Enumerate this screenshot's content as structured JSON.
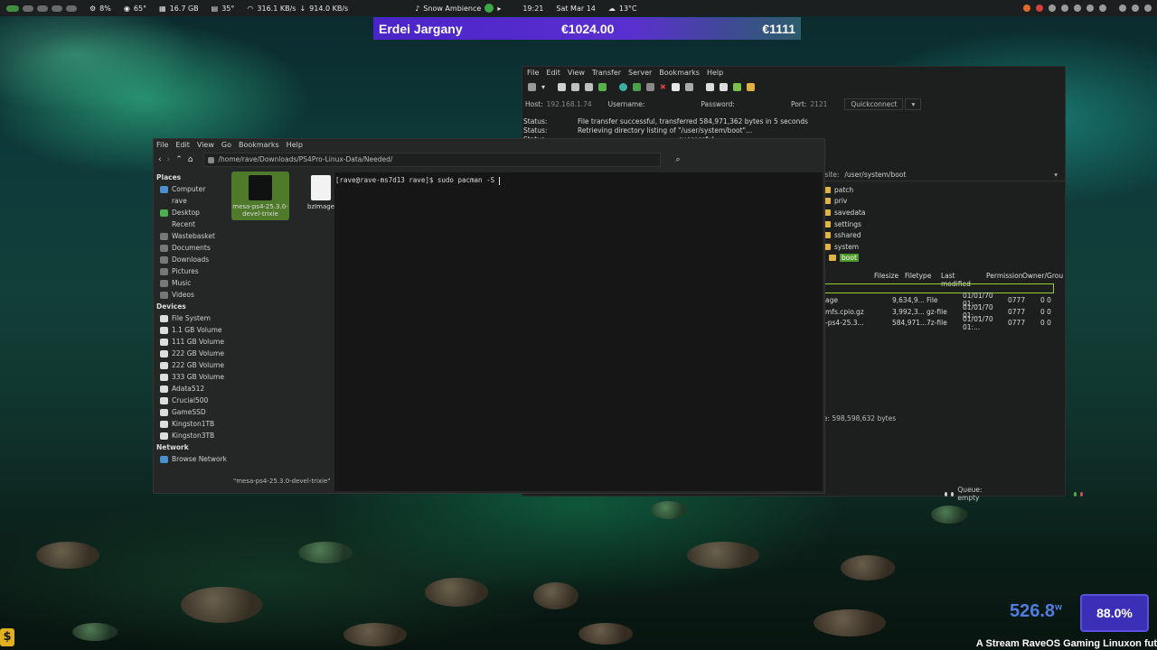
{
  "topbar": {
    "cpu": "8%",
    "temp": "65°",
    "ram": "16.7 GB",
    "temp2": "35°",
    "net_down": "316.1 KB/s",
    "net_up": "914.0 KB/s",
    "music": "Snow Ambience",
    "time": "19:21",
    "date": "Sat Mar 14",
    "weather": "13°C"
  },
  "banner": {
    "name": "Erdei Jargany",
    "amount": "€1024.00",
    "goal": "€1111"
  },
  "filezilla": {
    "menu": [
      "File",
      "Edit",
      "View",
      "Transfer",
      "Server",
      "Bookmarks",
      "Help"
    ],
    "host_label": "Host:",
    "host": "192.168.1.74",
    "user_label": "Username:",
    "pass_label": "Password:",
    "port_label": "Port:",
    "port": "2121",
    "quickconnect": "Quickconnect",
    "log": [
      {
        "k": "Status:",
        "v": "File transfer successful, transferred 584,971,362 bytes in 5 seconds"
      },
      {
        "k": "Status:",
        "v": "Retrieving directory listing of \"/user/system/boot\"..."
      },
      {
        "k": "Status:",
        "v": "successful"
      }
    ],
    "remote_label": "Remote site:",
    "remote_path": "/user/system/boot",
    "tree": [
      "patch",
      "priv",
      "savedata",
      "settings",
      "sshared",
      "system",
      "boot"
    ],
    "columns": [
      "Filesize",
      "Filetype",
      "Last modified",
      "Permission",
      "Owner/Group"
    ],
    "files": [
      {
        "name": "age",
        "size": "9,634,9...",
        "type": "File",
        "mod": "01/01/70 01:...",
        "perm": "0777",
        "own": "0 0"
      },
      {
        "name": "mfs.cpio.gz",
        "size": "3,992,3...",
        "type": "gz-file",
        "mod": "01/01/70 01:...",
        "perm": "0777",
        "own": "0 0"
      },
      {
        "name": "-ps4-25.3...",
        "size": "584,971...",
        "type": "7z-file",
        "mod": "01/01/70 01:...",
        "perm": "0777",
        "own": "0 0"
      }
    ],
    "total": "Total size: 598,598,632 bytes",
    "queue": "Queue: empty"
  },
  "filemanager": {
    "menu": [
      "File",
      "Edit",
      "View",
      "Go",
      "Bookmarks",
      "Help"
    ],
    "path": "/home/rave/Downloads/PS4Pro-Linux-Data/Needed/",
    "places_header": "Places",
    "places": [
      "Computer",
      "rave",
      "Desktop",
      "Recent",
      "Wastebasket",
      "Documents",
      "Downloads",
      "Pictures",
      "Music",
      "Videos"
    ],
    "devices_header": "Devices",
    "devices": [
      "File System",
      "1.1 GB Volume",
      "111 GB Volume",
      "222 GB Volume",
      "222 GB Volume",
      "333 GB Volume",
      "Adata512",
      "Crucial500",
      "GameSSD",
      "Kingston1TB",
      "Kingston3TB"
    ],
    "network_header": "Network",
    "network": [
      "Browse Network"
    ],
    "files": [
      {
        "label": "mesa-ps4-25.3.0-devel-trixie"
      },
      {
        "label": "bzImage"
      }
    ],
    "status": "\"mesa-ps4-25.3.0-devel-trixie\""
  },
  "terminal": {
    "prompt": "[rave@rave-ms7d13 rave]$ sudo pacman -S "
  },
  "overlay": {
    "power": "526.8",
    "power_unit": "w",
    "percent": "88.0%",
    "ticker": "A Stream RaveOS Gaming Linuxon fut",
    "dollar": "$"
  }
}
